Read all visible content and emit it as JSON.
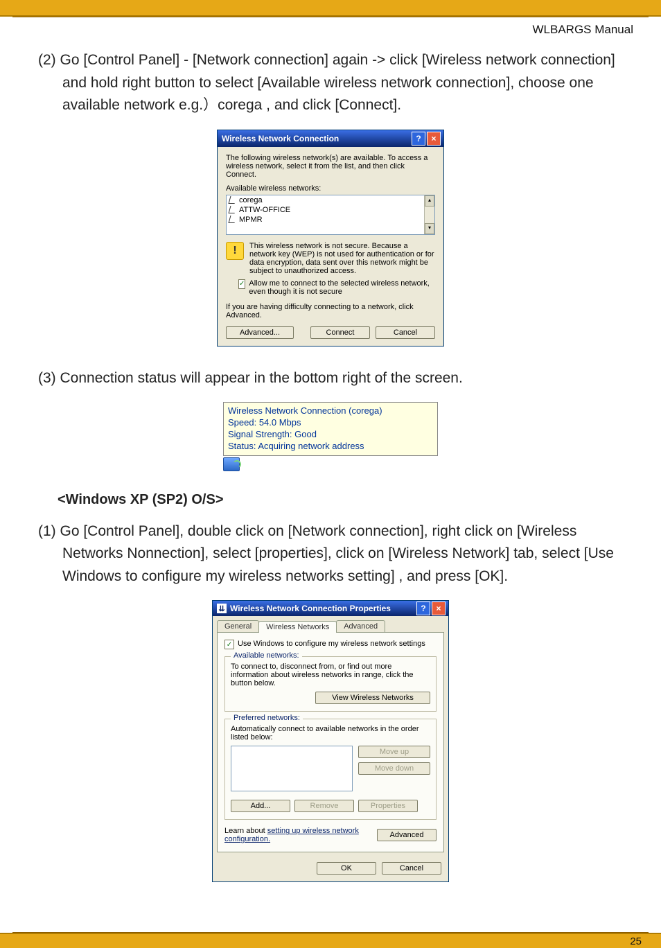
{
  "header": {
    "manual": "WLBARGS Manual"
  },
  "steps": {
    "s2": "(2) Go [Control Panel] - [Network connection] again -> click [Wireless network connection] and hold right button to select [Available wireless network connection], choose one available network e.g.）corega , and click [Connect].",
    "s3": "(3) Connection status will appear in the bottom right of the screen.",
    "s1sp2": "(1) Go [Control Panel], double click on [Network connection], right click on [Wireless Networks Nonnection], select [properties], click on [Wireless Network] tab, select [Use Windows to configure my wireless networks setting] , and press [OK]."
  },
  "section": {
    "xpsp2": "<Windows XP (SP2) O/S>"
  },
  "dialog1": {
    "title": "Wireless Network Connection",
    "intro": "The following wireless network(s) are available. To access a wireless network, select it from the list, and then click Connect.",
    "available_label": "Available wireless networks:",
    "networks": [
      "corega",
      "ATTW-OFFICE",
      "MPMR"
    ],
    "warning": "This wireless network is not secure. Because a network key (WEP) is not used for authentication or for data encryption, data sent over this network might be subject to unauthorized access.",
    "allow": "Allow me to connect to the selected wireless network, even though it is not secure",
    "difficulty": "If you are having difficulty connecting to a network, click Advanced.",
    "btn_advanced": "Advanced...",
    "btn_connect": "Connect",
    "btn_cancel": "Cancel"
  },
  "balloon": {
    "title": "Wireless Network Connection (corega)",
    "speed": "Speed: 54.0 Mbps",
    "signal": "Signal Strength: Good",
    "status": "Status: Acquiring network address"
  },
  "dialog2": {
    "title": "Wireless Network Connection Properties",
    "tabs": [
      "General",
      "Wireless Networks",
      "Advanced"
    ],
    "use_windows": "Use Windows to configure my wireless network settings",
    "grp_available": "Available networks:",
    "available_text": "To connect to, disconnect from, or find out more information about wireless networks in range, click the button below.",
    "btn_view": "View Wireless Networks",
    "grp_preferred": "Preferred networks:",
    "preferred_text": "Automatically connect to available networks in the order listed below:",
    "btn_moveup": "Move up",
    "btn_movedown": "Move down",
    "btn_add": "Add...",
    "btn_remove": "Remove",
    "btn_props": "Properties",
    "learn_pre": "Learn about ",
    "learn_link": "setting up wireless network configuration.",
    "btn_advanced": "Advanced",
    "btn_ok": "OK",
    "btn_cancel": "Cancel"
  },
  "footer": {
    "page": "25"
  }
}
